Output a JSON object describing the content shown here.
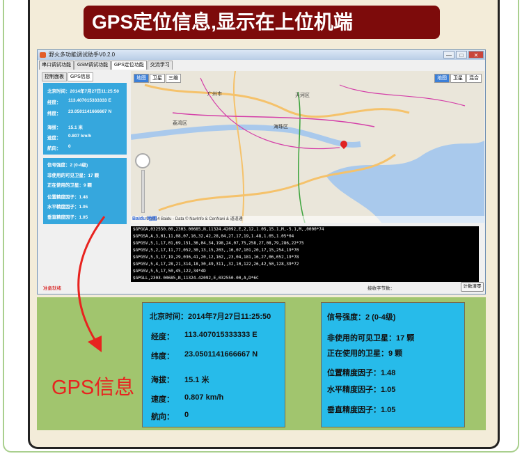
{
  "banner": {
    "title": "GPS定位信息,显示在上位机端"
  },
  "window": {
    "title": "野火多功能调试助手V0.2.0",
    "buttons": [
      "—",
      "□",
      "✕"
    ],
    "tabs": [
      "串口调试功能",
      "GSM调试功能",
      "GPS定位功能",
      "交流学习"
    ],
    "active_tab": 2,
    "subtabs": [
      "控制面板",
      "GPS信息"
    ],
    "active_subtab": 1
  },
  "small_info": {
    "time_label": "北京时间：",
    "time_value": "2014年7月27日11:25:50",
    "lng_label": "经度：",
    "lng_value": "113.407015333333 E",
    "lat_label": "纬度：",
    "lat_value": "23.0501141666667 N",
    "alt_label": "海拔：",
    "alt_value": "15.1 米",
    "speed_label": "速度：",
    "speed_value": "0.807 km/h",
    "course_label": "航向：",
    "course_value": "0",
    "signal_label": "信号强度：",
    "signal_value": "2 (0-4级)",
    "visible_label": "非使用的可见卫星：",
    "visible_value": "17 颗",
    "using_label": "正在使用的卫星：",
    "using_value": "9 颗",
    "pdop_label": "位置精度因子：",
    "pdop_value": "1.48",
    "hdop_label": "水平精度因子：",
    "hdop_value": "1.05",
    "vdop_label": "垂直精度因子：",
    "vdop_value": "1.05"
  },
  "map": {
    "left_buttons": [
      "地图",
      "卫星",
      "三维"
    ],
    "right_buttons": [
      "地图",
      "卫星",
      "混合"
    ],
    "labels": [
      "广州市",
      "天河区",
      "海珠区",
      "荔湾区"
    ],
    "footer": "© 2014 Baidu - Data © NavInfo & CenNavi & 道道通",
    "logo": "Baidu 地图"
  },
  "console_lines": [
    "$GPGGA,032550.00,2303.00685,N,11324.42092,E,2,12,1.05,15.1,M,-5.1,M,,0000*74",
    "$GPGSA,A,3,01,11,08,07,16,32,42,28,04,27,17,19,1.48,1.05,1.05*04",
    "$GPGSV,5,1,17,01,69,151,36,04,34,198,24,07,75,258,27,08,79,286,22*75",
    "$GPGSV,5,2,17,11,77,052,30,13,15,203,,16,07,101,20,17,15,254,19*70",
    "$GPGSV,5,3,17,19,29,036,41,20,12,162,,23,04,181,16,27,06,052,19*78",
    "$GPGSV,5,4,17,28,21,314,18,30,49,311,,32,10,122,26,42,50,128,39*72",
    "$GPGSV,5,5,17,50,45,122,34*4D",
    "$GPGLL,2303.00685,N,11324.42092,E,032550.00,A,D*6C"
  ],
  "status": {
    "ready": "准备就绪",
    "recv_label": "接收字节数：",
    "count_button": "计数清零"
  },
  "gps_info_title": "GPS信息",
  "big_info": {
    "time_label": "北京时间：",
    "time_value": "2014年7月27日11:25:50",
    "lng_label": "经度：",
    "lng_value": "113.407015333333 E",
    "lat_label": "纬度：",
    "lat_value": "23.0501141666667 N",
    "alt_label": "海拔：",
    "alt_value": "15.1 米",
    "speed_label": "速度：",
    "speed_value": "0.807 km/h",
    "course_label": "航向：",
    "course_value": "0",
    "signal_label": "信号强度：",
    "signal_value": "2 (0-4级)",
    "visible_label": "非使用的可见卫星：",
    "visible_value": "17 颗",
    "using_label": "正在使用的卫星：",
    "using_value": "9 颗",
    "pdop_label": "位置精度因子：",
    "pdop_value": "1.48",
    "hdop_label": "水平精度因子：",
    "hdop_value": "1.05",
    "vdop_label": "垂直精度因子：",
    "vdop_value": "1.05"
  },
  "colors": {
    "banner": "#7d0b0b",
    "info_blue": "#27bbea",
    "green": "#a1c56e",
    "accent_red": "#e8231f"
  }
}
